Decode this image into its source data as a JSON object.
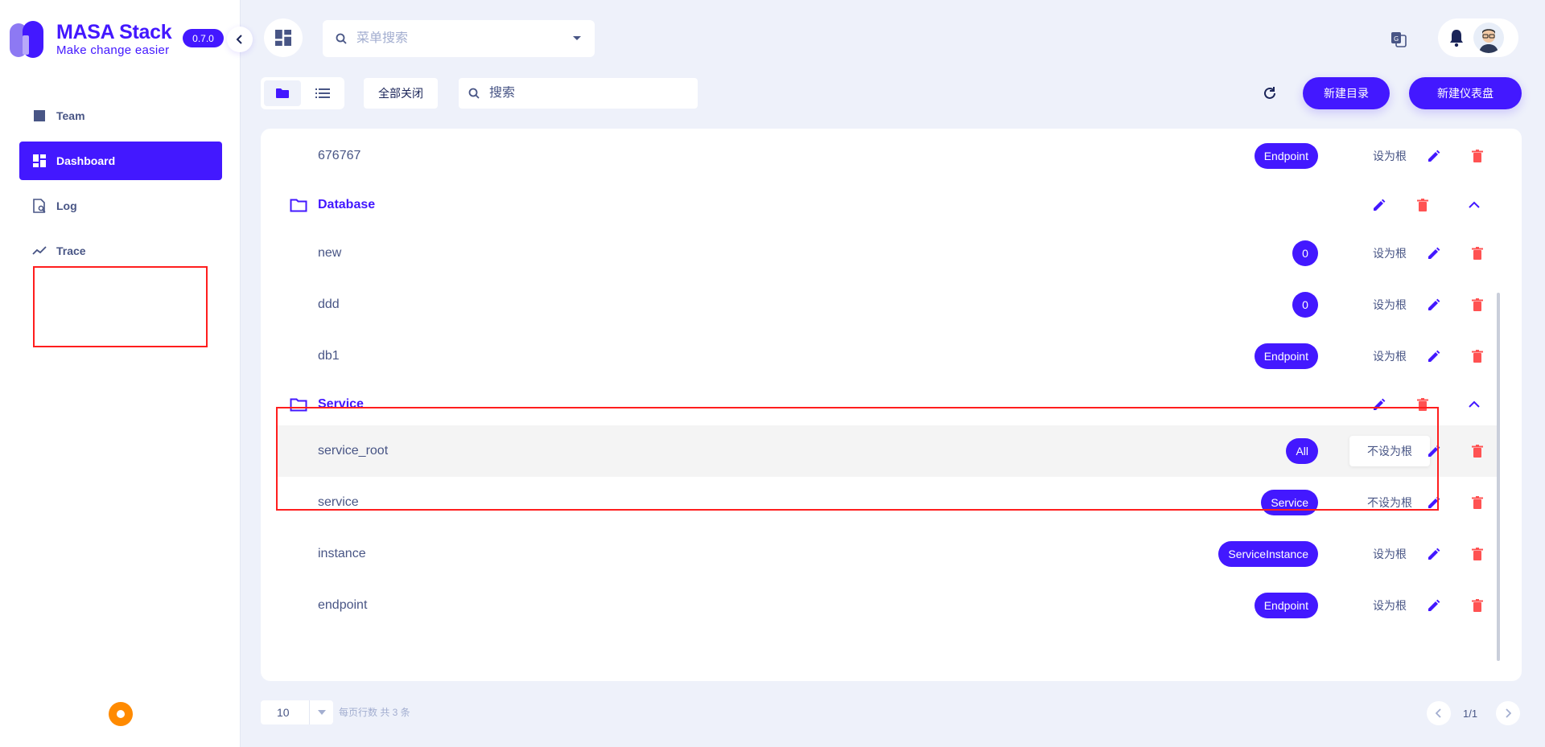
{
  "app": {
    "brand": "MASA Stack",
    "tagline": "Make change easier",
    "version": "0.7.0"
  },
  "sidebar": {
    "items": [
      {
        "label": "Team",
        "icon": "team-icon",
        "active": false
      },
      {
        "label": "Dashboard",
        "icon": "dashboard-icon",
        "active": true
      },
      {
        "label": "Log",
        "icon": "log-icon",
        "active": false
      },
      {
        "label": "Trace",
        "icon": "trace-icon",
        "active": false
      }
    ]
  },
  "header": {
    "menu_search_placeholder": "菜单搜索"
  },
  "toolbar": {
    "close_all": "全部关闭",
    "search_placeholder": "搜索",
    "new_folder": "新建目录",
    "new_dashboard": "新建仪表盘"
  },
  "rows": [
    {
      "name": "676767",
      "chip": "Endpoint",
      "root": "设为根"
    },
    {
      "folder": "Database"
    },
    {
      "name": "new",
      "chip": "0",
      "root": "设为根"
    },
    {
      "name": "ddd",
      "chip": "0",
      "root": "设为根"
    },
    {
      "name": "db1",
      "chip": "Endpoint",
      "root": "设为根"
    },
    {
      "folder": "Service"
    },
    {
      "name": "service_root",
      "chip": "All",
      "root": "不设为根"
    },
    {
      "name": "service",
      "chip": "Service",
      "root": "不设为根"
    },
    {
      "name": "instance",
      "chip": "ServiceInstance",
      "root": "设为根"
    },
    {
      "name": "endpoint",
      "chip": "Endpoint",
      "root": "设为根"
    }
  ],
  "pager": {
    "page_size": "10",
    "info": "每页行数  共 3 条",
    "page": "1/1"
  },
  "colors": {
    "primary": "#4318FF",
    "danger": "#FF5252",
    "text": "#485585",
    "background": "#EEF1FA",
    "highlight": "#FF1E1E",
    "fab": "#FF8A00"
  }
}
